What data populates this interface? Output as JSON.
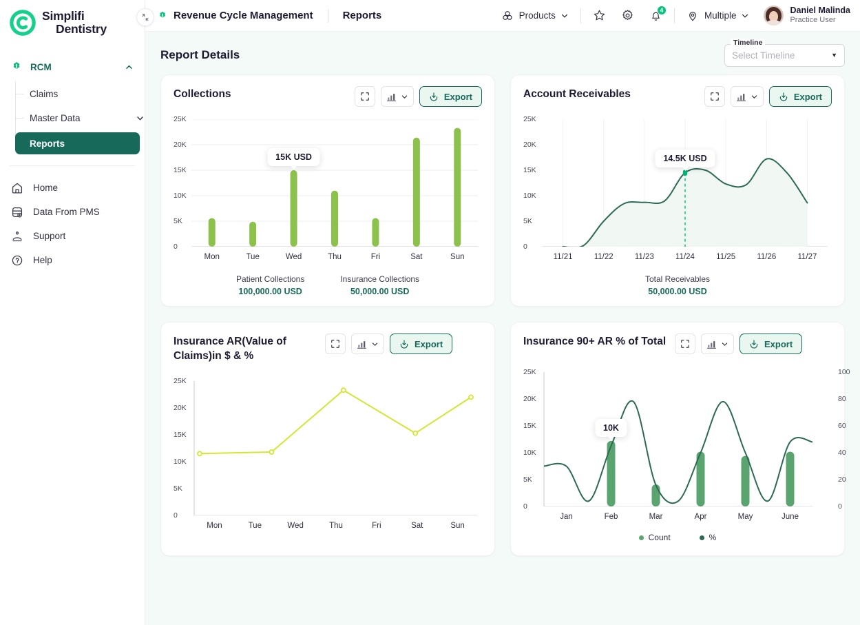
{
  "brand": {
    "line1": "Simplifi",
    "line2": "Dentistry",
    "logo_icon": "simplifi-logo"
  },
  "sidebar": {
    "group": {
      "label": "RCM",
      "icon": "rcm-icon",
      "chevron": "chevron-up-icon"
    },
    "subitems": [
      {
        "label": "Claims",
        "active": false,
        "chevron": ""
      },
      {
        "label": "Master Data",
        "active": false,
        "chevron": "chevron-down-icon"
      },
      {
        "label": "Reports",
        "active": true,
        "chevron": ""
      }
    ],
    "main": [
      {
        "label": "Home",
        "icon": "home-icon"
      },
      {
        "label": "Data From PMS",
        "icon": "database-icon"
      },
      {
        "label": "Support",
        "icon": "support-icon"
      },
      {
        "label": "Help",
        "icon": "help-circle-icon"
      }
    ],
    "collapse_icon": "collapse-sidebar-icon"
  },
  "topbar": {
    "dot_icon": "app-dot-icon",
    "title": "Revenue Cycle Management",
    "subtitle": "Reports",
    "products": {
      "label": "Products",
      "icon": "products-icon",
      "caret": "chevron-down-icon"
    },
    "star_icon": "star-icon",
    "gear_icon": "gear-icon",
    "bell_icon": "bell-icon",
    "bell_badge": "4",
    "location": {
      "label": "Multiple",
      "icon": "location-pin-icon",
      "caret": "chevron-down-icon"
    },
    "user": {
      "name": "Daniel Malinda",
      "role": "Practice User",
      "avatar": "user-avatar"
    }
  },
  "page": {
    "title": "Report Details",
    "timeline": {
      "legend": "Timeline",
      "placeholder": "Select Timeline",
      "value": "",
      "caret": "caret-down-icon"
    }
  },
  "tools": {
    "fullscreen_icon": "fullscreen-icon",
    "charttype_icon": "bar-chart-icon",
    "charttype_caret": "chevron-down-icon",
    "export_label": "Export",
    "export_icon": "export-download-icon"
  },
  "colors": {
    "brand_green": "#17695a",
    "accent_green": "#00c37a",
    "bar_green": "#8cc14c",
    "line_dark_green": "#2c6a53",
    "line_yellow": "#d4e533",
    "bar_mid_green": "#5aa46f",
    "area_fill": "#eef7f2"
  },
  "chart_data": [
    {
      "id": "collections",
      "type": "bar",
      "title": "Collections",
      "categories": [
        "Mon",
        "Tue",
        "Wed",
        "Thu",
        "Fri",
        "Sat",
        "Sun"
      ],
      "values": [
        5600,
        4900,
        15000,
        11000,
        5600,
        21400,
        23300
      ],
      "ylim": [
        0,
        25000
      ],
      "yticks": [
        0,
        5000,
        10000,
        15000,
        20000,
        25000
      ],
      "ytick_labels": [
        "0",
        "5K",
        "10K",
        "15K",
        "20K",
        "25K"
      ],
      "xlabel": "",
      "ylabel": "",
      "grid": true,
      "series_color": "#8cc14c",
      "tooltip": {
        "text": "15K USD",
        "at_category": "Wed",
        "value": 15000
      },
      "footer": [
        {
          "label": "Patient Collections",
          "value": "100,000.00 USD"
        },
        {
          "label": "Insurance Collections",
          "value": "50,000.00 USD"
        }
      ]
    },
    {
      "id": "account-receivables",
      "type": "area",
      "title": "Account Receivables",
      "categories": [
        "11/21",
        "11/22",
        "11/23",
        "11/24",
        "11/25",
        "11/26",
        "11/27"
      ],
      "values": [
        0,
        5000,
        8700,
        14500,
        12300,
        17200,
        8600
      ],
      "ylim": [
        0,
        25000
      ],
      "yticks": [
        0,
        5000,
        10000,
        15000,
        20000,
        25000
      ],
      "ytick_labels": [
        "0",
        "5K",
        "10K",
        "15K",
        "20K",
        "25K"
      ],
      "xlabel": "",
      "ylabel": "",
      "grid": true,
      "series_color": "#2c6a53",
      "fill_color": "#eef7f2",
      "tooltip": {
        "text": "14.5K USD",
        "at_category": "11/24",
        "value": 14500
      },
      "marker_color": "#00b377",
      "footer": [
        {
          "label": "Total Receivables",
          "value": "50,000.00 USD"
        }
      ]
    },
    {
      "id": "insurance-ar-value-of-claims",
      "type": "line",
      "title": "Insurance AR(Value of Claims)in $ & %",
      "categories": [
        "Mon",
        "Tue",
        "Wed",
        "Thu",
        "Fri",
        "Sat",
        "Sun"
      ],
      "values": [
        11500,
        11800,
        23300,
        15300,
        22000
      ],
      "point_x_fraction": [
        0.0,
        0.265,
        0.53,
        0.795,
        1.0
      ],
      "ylim": [
        0,
        25000
      ],
      "yticks": [
        0,
        5000,
        10000,
        15000,
        20000,
        25000
      ],
      "ytick_labels": [
        "0",
        "5K",
        "10K",
        "15K",
        "20K",
        "25K"
      ],
      "xlabel": "",
      "ylabel": "",
      "grid": false,
      "series_color": "#d4e533"
    },
    {
      "id": "insurance-90-plus-ar-pct-of-total",
      "type": "bar+line",
      "title": "Insurance 90+ AR % of Total",
      "categories": [
        "Jan",
        "Feb",
        "Mar",
        "Apr",
        "May",
        "June"
      ],
      "series": [
        {
          "name": "Count",
          "type": "bar",
          "color": "#5aa46f",
          "values": [
            0,
            12200,
            4100,
            10200,
            9400,
            10200
          ]
        },
        {
          "name": "%",
          "type": "line",
          "color": "#2c6a53",
          "values": [
            30,
            45,
            16,
            40,
            40,
            48
          ]
        }
      ],
      "ylim": [
        0,
        25000
      ],
      "yticks": [
        0,
        5000,
        10000,
        15000,
        20000,
        25000
      ],
      "ytick_labels": [
        "0",
        "5K",
        "10K",
        "15K",
        "20K",
        "25K"
      ],
      "y2lim": [
        0,
        100
      ],
      "y2ticks": [
        0,
        20,
        40,
        60,
        80,
        100
      ],
      "y2tick_labels": [
        "0",
        "20",
        "40",
        "60",
        "80",
        "100"
      ],
      "xlabel": "",
      "ylabel": "",
      "grid": false,
      "legend": [
        {
          "label": "Count",
          "color": "#5aa46f"
        },
        {
          "label": "%",
          "color": "#2c6a53"
        }
      ],
      "tooltip": {
        "text": "10K",
        "at_category": "Feb",
        "value": 10000
      }
    }
  ]
}
